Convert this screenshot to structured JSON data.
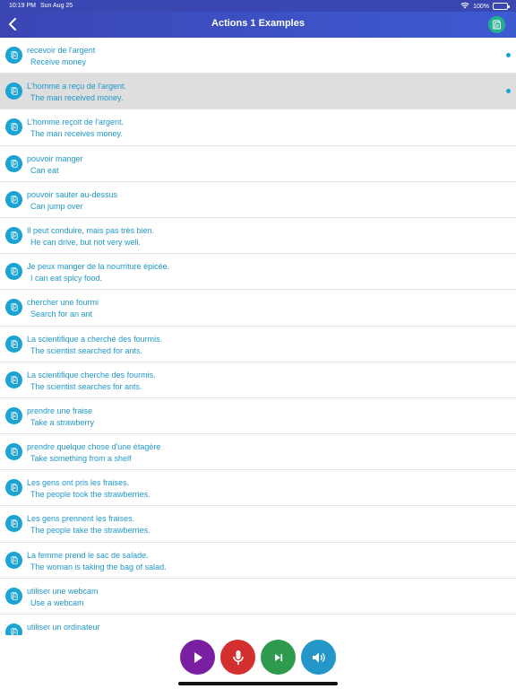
{
  "status": {
    "time": "10:19 PM",
    "date": "Sun Aug 25",
    "battery": "100%"
  },
  "nav": {
    "title": "Actions 1 Examples",
    "back_icon": "chevron-left-icon",
    "action_icon": "flashcard-icon"
  },
  "colors": {
    "nav": "#3b46b4",
    "text": "#1f97cc",
    "row_icon": "#1aa3d4",
    "play": "#7b1fa2",
    "record": "#d32f2f",
    "next": "#2e9a4e",
    "speaker": "#2596c8"
  },
  "items": [
    {
      "fr": "recevoir de l'argent",
      "en": "Receive money",
      "dot": true
    },
    {
      "fr": "L'homme a reçu de l'argent.",
      "en": "The man received money.",
      "dot": true,
      "selected": true
    },
    {
      "fr": "L'homme reçoit de l'argent.",
      "en": "The man receives money."
    },
    {
      "fr": "pouvoir manger",
      "en": "Can eat"
    },
    {
      "fr": "pouvoir sauter au-dessus",
      "en": "Can jump over"
    },
    {
      "fr": "Il peut conduire, mais pas très bien.",
      "en": "He can drive, but not very well."
    },
    {
      "fr": "Je peux manger de la nourriture épicée.",
      "en": "I can eat spicy food."
    },
    {
      "fr": "chercher une fourmi",
      "en": "Search for an ant"
    },
    {
      "fr": "La scientifique a cherché des fourmis.",
      "en": "The scientist searched for ants."
    },
    {
      "fr": "La scientifique cherche des fourmis.",
      "en": "The scientist searches for ants."
    },
    {
      "fr": "prendre une fraise",
      "en": "Take a strawberry"
    },
    {
      "fr": "prendre quelque chose d'une étagère",
      "en": "Take something from a shelf"
    },
    {
      "fr": "Les gens ont pris les fraises.",
      "en": "The people took the strawberries."
    },
    {
      "fr": "Les gens prennent les fraises.",
      "en": "The people take the strawberries."
    },
    {
      "fr": "La femme prend le sac de salade.",
      "en": "The woman is taking the bag of salad."
    },
    {
      "fr": "utiliser une webcam",
      "en": "Use a webcam"
    },
    {
      "fr": "utiliser un ordinateur",
      "en": ""
    }
  ],
  "controls": {
    "play_icon": "play-icon",
    "record_icon": "microphone-icon",
    "next_icon": "skip-next-icon",
    "speaker_icon": "speaker-icon"
  }
}
